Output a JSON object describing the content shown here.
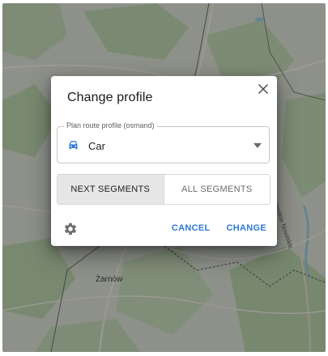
{
  "map": {
    "place_label": "Żarnów",
    "road_label": "Rogowskie Nowiskie",
    "water_color": "#7cc3e0",
    "forest_color": "#bcd9b0"
  },
  "dialog": {
    "title": "Change profile",
    "close_icon": "close-icon",
    "profile_field": {
      "legend": "Plan route profile (osmand)",
      "value": "Car",
      "icon": "car-icon",
      "icon_color": "#2b78d6",
      "dropdown_icon": "chevron-down-icon"
    },
    "segments": {
      "options": [
        "NEXT SEGMENTS",
        "ALL SEGMENTS"
      ],
      "selected": "NEXT SEGMENTS"
    },
    "footer": {
      "settings_icon": "gear-icon",
      "cancel_label": "CANCEL",
      "change_label": "CHANGE",
      "accent_color": "#2b78d6"
    }
  }
}
